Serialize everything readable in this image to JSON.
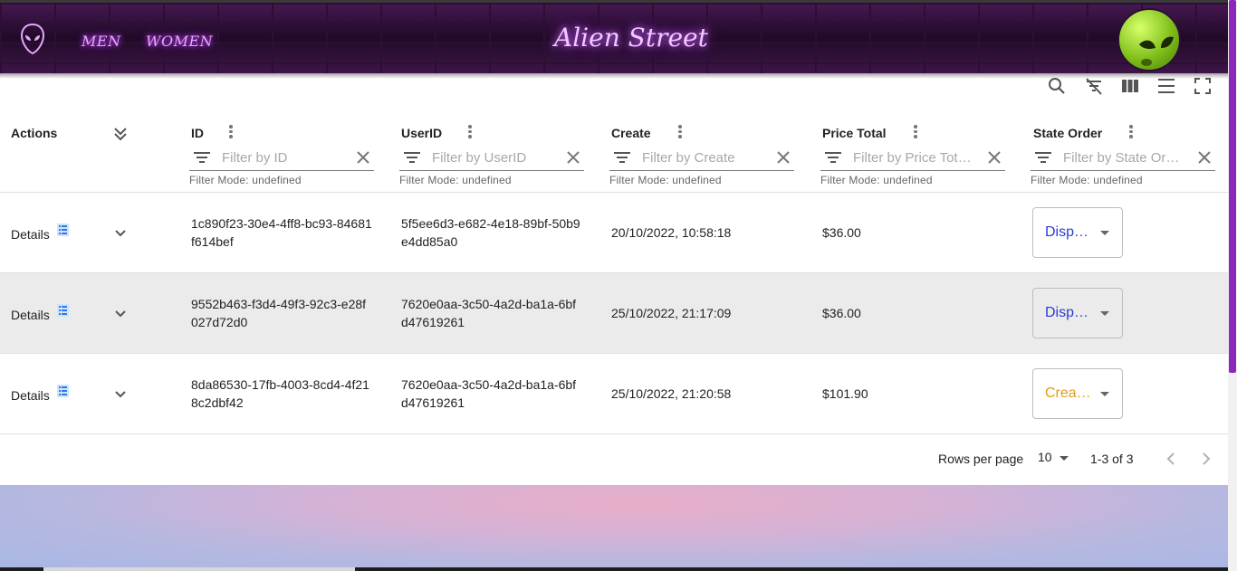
{
  "header": {
    "nav": [
      "MEN",
      "WOMEN"
    ],
    "brand": "Alien Street"
  },
  "toolbar": {
    "icons": [
      "search-icon",
      "filter-off-icon",
      "columns-icon",
      "density-icon",
      "fullscreen-icon"
    ]
  },
  "table": {
    "actions_header": "Actions",
    "columns": [
      {
        "label": "ID",
        "placeholder": "Filter by ID"
      },
      {
        "label": "UserID",
        "placeholder": "Filter by UserID"
      },
      {
        "label": "Create",
        "placeholder": "Filter by Create"
      },
      {
        "label": "Price Total",
        "placeholder": "Filter by Price Tot…"
      },
      {
        "label": "State Order",
        "placeholder": "Filter by State Or…"
      }
    ],
    "filter_mode": "Filter Mode: undefined",
    "details_label": "Details",
    "rows": [
      {
        "id": "1c890f23-30e4-4ff8-bc93-84681f614bef",
        "user_id": "5f5ee6d3-e682-4e18-89bf-50b9e4dd85a0",
        "created": "20/10/2022, 10:58:18",
        "price": "$36.00",
        "state": "Disp…",
        "state_color": "#2a3bd1"
      },
      {
        "id": "9552b463-f3d4-49f3-92c3-e28f027d72d0",
        "user_id": "7620e0aa-3c50-4a2d-ba1a-6bfd47619261",
        "created": "25/10/2022, 21:17:09",
        "price": "$36.00",
        "state": "Disp…",
        "state_color": "#2a3bd1"
      },
      {
        "id": "8da86530-17fb-4003-8cd4-4f218c2dbf42",
        "user_id": "7620e0aa-3c50-4a2d-ba1a-6bfd47619261",
        "created": "25/10/2022, 21:20:58",
        "price": "$101.90",
        "state": "Crea…",
        "state_color": "#e59a14"
      }
    ]
  },
  "pagination": {
    "rows_per_page_label": "Rows per page",
    "rows_per_page": "10",
    "range": "1-3 of 3"
  },
  "colors": {
    "accent": "#8c29b8",
    "neon": "#e8a6ff"
  }
}
